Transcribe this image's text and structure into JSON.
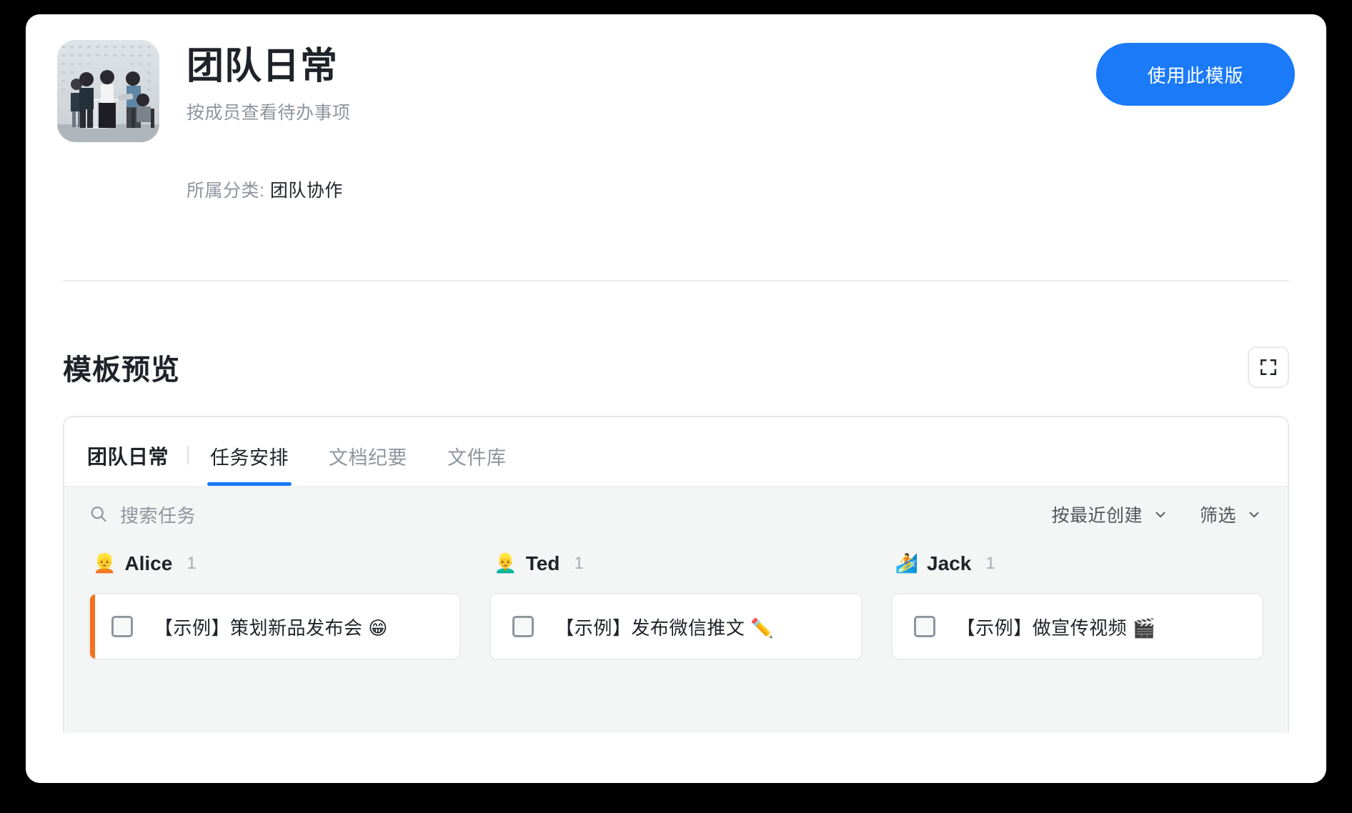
{
  "header": {
    "title": "团队日常",
    "subtitle": "按成员查看待办事项",
    "category_label": "所属分类:",
    "category_value": "团队协作",
    "use_template_button": "使用此模版"
  },
  "preview": {
    "section_title": "模板预览",
    "expand_tooltip": "全屏"
  },
  "panel": {
    "doc_title": "团队日常",
    "tabs": [
      {
        "label": "任务安排",
        "active": true
      },
      {
        "label": "文档纪要",
        "active": false
      },
      {
        "label": "文件库",
        "active": false
      }
    ],
    "search_placeholder": "搜索任务",
    "sort_label": "按最近创建",
    "filter_label": "筛选",
    "columns": [
      {
        "emoji": "👱",
        "name": "Alice",
        "count": "1",
        "accent": "#F5711C",
        "tasks": [
          {
            "text": "【示例】策划新品发布会 😁",
            "checked": false,
            "accent": true
          }
        ]
      },
      {
        "emoji": "👱‍♂️",
        "name": "Ted",
        "count": "1",
        "accent": "",
        "tasks": [
          {
            "text": "【示例】发布微信推文 ✏️",
            "checked": false,
            "accent": false
          }
        ]
      },
      {
        "emoji": "🏄",
        "name": "Jack",
        "count": "1",
        "accent": "",
        "tasks": [
          {
            "text": "【示例】做宣传视频 🎬",
            "checked": false,
            "accent": false
          }
        ]
      }
    ]
  },
  "colors": {
    "brand_blue": "#1A7AF8",
    "accent_orange": "#F5711C",
    "text_primary": "#1F2329",
    "text_muted": "#8F959E",
    "panel_bg": "#F4F5F5"
  }
}
